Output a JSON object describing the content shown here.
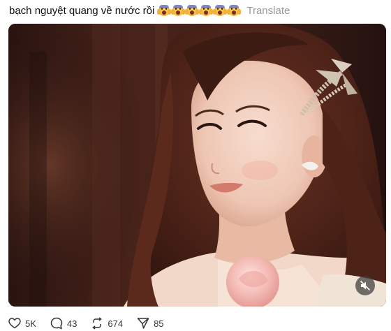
{
  "post": {
    "caption": "bạch nguyệt quang về nước rồi",
    "emojis": [
      "crying-face-emoji",
      "crying-face-emoji",
      "crying-face-emoji",
      "crying-face-emoji",
      "crying-face-emoji",
      "crying-face-emoji"
    ],
    "translate_label": "Translate"
  },
  "media": {
    "description_icon": "muted-speaker-icon"
  },
  "actions": {
    "likes": "5K",
    "replies": "43",
    "reposts": "674",
    "shares": "85"
  },
  "colors": {
    "translate": "#9a9a9a",
    "text": "#101010",
    "mute_bg": "#3c3c3c"
  }
}
